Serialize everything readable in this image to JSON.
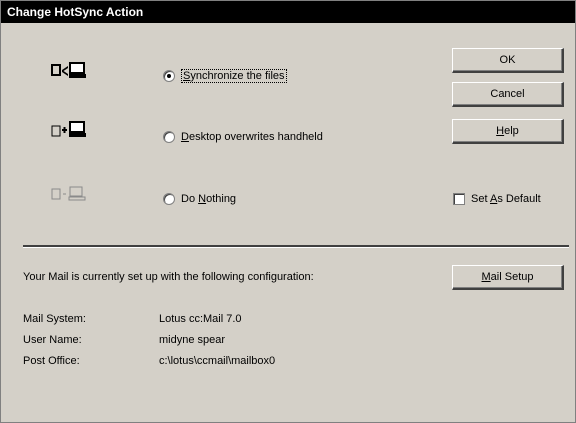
{
  "window": {
    "title": "Change HotSync Action"
  },
  "options": [
    {
      "label_prefix": "",
      "label_underlined": "S",
      "label_suffix": "ynchronize the files",
      "icon": "sync-icon",
      "checked": true
    },
    {
      "label_prefix": "",
      "label_underlined": "D",
      "label_suffix": "esktop overwrites handheld",
      "icon": "desktop-overwrites-handheld-icon",
      "checked": false
    },
    {
      "label_prefix": "Do ",
      "label_underlined": "N",
      "label_suffix": "othing",
      "icon": "do-nothing-icon",
      "checked": false
    }
  ],
  "buttons": {
    "ok": "OK",
    "cancel": "Cancel",
    "help_underlined": "H",
    "help_rest": "elp",
    "mail_setup_underlined": "M",
    "mail_setup_rest": "ail Setup"
  },
  "set_default": {
    "prefix": "Set ",
    "underlined": "A",
    "suffix": "s Default",
    "checked": false
  },
  "config": {
    "intro": "Your Mail is currently set up with the following configuration:",
    "rows": [
      {
        "label": "Mail System:",
        "value": "Lotus cc:Mail 7.0"
      },
      {
        "label": "User Name:",
        "value": "midyne spear"
      },
      {
        "label": "Post Office:",
        "value": "c:\\lotus\\ccmail\\mailbox0"
      }
    ]
  },
  "colors": {
    "face": "#d4d0c8",
    "titlebar": "#000000",
    "title_text": "#ffffff"
  }
}
